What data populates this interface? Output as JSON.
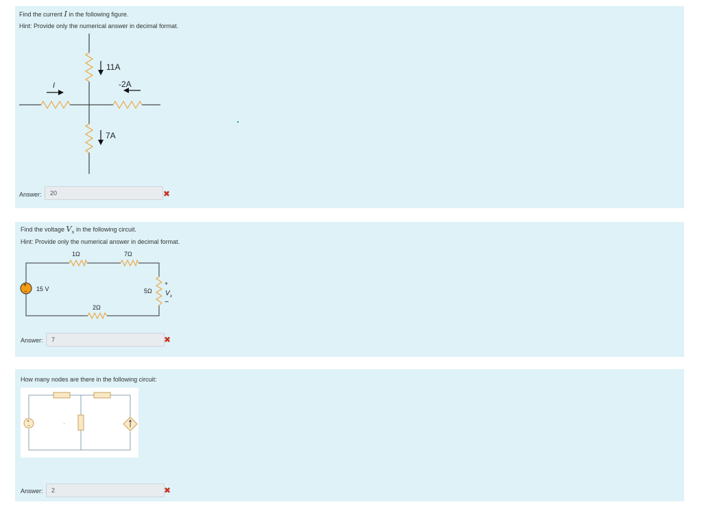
{
  "q1": {
    "text_before": "Find the current ",
    "var": "I",
    "text_after": " in the following figure.",
    "hint": "Hint: Provide only the numerical answer in decimal format.",
    "figure": {
      "top": "11A",
      "right": "-2A",
      "bottom": "7A",
      "left": "I"
    },
    "answer_label": "Answer:",
    "answer_value": "20",
    "status_icon": "incorrect-x"
  },
  "q2": {
    "text_before": "Find the voltage ",
    "var": "V",
    "var_sub": "x",
    "text_after": " in the following circuit.",
    "hint": "Hint: Provide only the numerical answer in decimal format.",
    "circuit": {
      "r1": "1Ω",
      "r2": "7Ω",
      "r3": "5Ω",
      "r4": "2Ω",
      "source": "15 V",
      "plus": "+",
      "minus": "−",
      "vx": "V",
      "vx_sub": "x",
      "source_plus": "+",
      "source_minus": "−"
    },
    "answer_label": "Answer:",
    "answer_value": "7",
    "status_icon": "incorrect-x"
  },
  "q3": {
    "text": "How many nodes are there in the following circuit:",
    "circuit": {
      "source_plus": "+",
      "source_minus": "−"
    },
    "answer_label": "Answer:",
    "answer_value": "2",
    "status_icon": "incorrect-x"
  },
  "colors": {
    "card_bg": "#def2f8",
    "resistor": "#f0a53c",
    "wire": "#222222",
    "incorrect": "#ca3120",
    "source_fill": "#f39c12"
  }
}
